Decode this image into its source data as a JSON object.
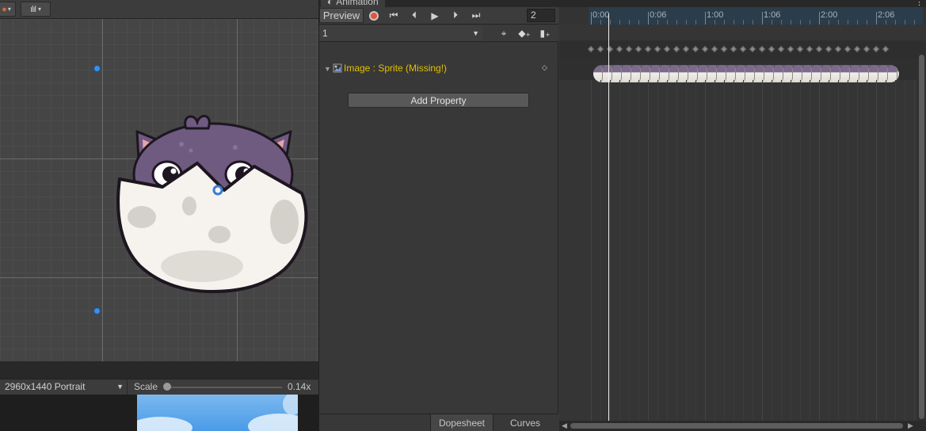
{
  "scene": {
    "toolbar_icons": [
      "gizmo-icon",
      "audio-waveform-icon"
    ]
  },
  "game_view": {
    "resolution": "2960x1440 Portrait",
    "scale_label": "Scale",
    "scale_value": "0.14x",
    "scale_level": 0.0
  },
  "animation": {
    "tab_title": "Animation",
    "preview_label": "Preview",
    "frame_value": "2",
    "clip_name": "1",
    "property": {
      "label": "Image : Sprite (Missing!)"
    },
    "add_property_label": "Add Property",
    "tabs": {
      "dopesheet": "Dopesheet",
      "curves": "Curves"
    },
    "timeline": {
      "ticks": [
        "0:00",
        "0:06",
        "1:00",
        "1:06",
        "2:00",
        "2:06"
      ],
      "playhead_time": "0:00"
    }
  },
  "colors": {
    "record": "#e2553d",
    "missing_property": "#e0c000",
    "ruler_range": "#2b3c4a",
    "handle_dot": "#3a8ee6"
  }
}
